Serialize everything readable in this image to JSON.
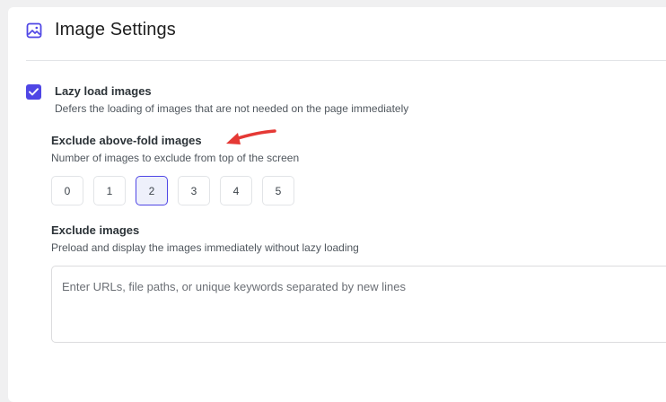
{
  "header": {
    "title": "Image Settings",
    "icon": "image-icon"
  },
  "lazy_load": {
    "label": "Lazy load images",
    "description": "Defers the loading of images that are not needed on the page immediately",
    "checked": true
  },
  "exclude_above_fold": {
    "label": "Exclude above-fold images",
    "description": "Number of images to exclude from top of the screen",
    "options": [
      "0",
      "1",
      "2",
      "3",
      "4",
      "5"
    ],
    "selected": "2"
  },
  "exclude_images": {
    "label": "Exclude images",
    "description": "Preload and display the images immediately without lazy loading",
    "placeholder": "Enter URLs, file paths, or unique keywords separated by new lines",
    "value": ""
  },
  "colors": {
    "accent": "#4f46e5",
    "annotation_arrow": "#e53935"
  }
}
